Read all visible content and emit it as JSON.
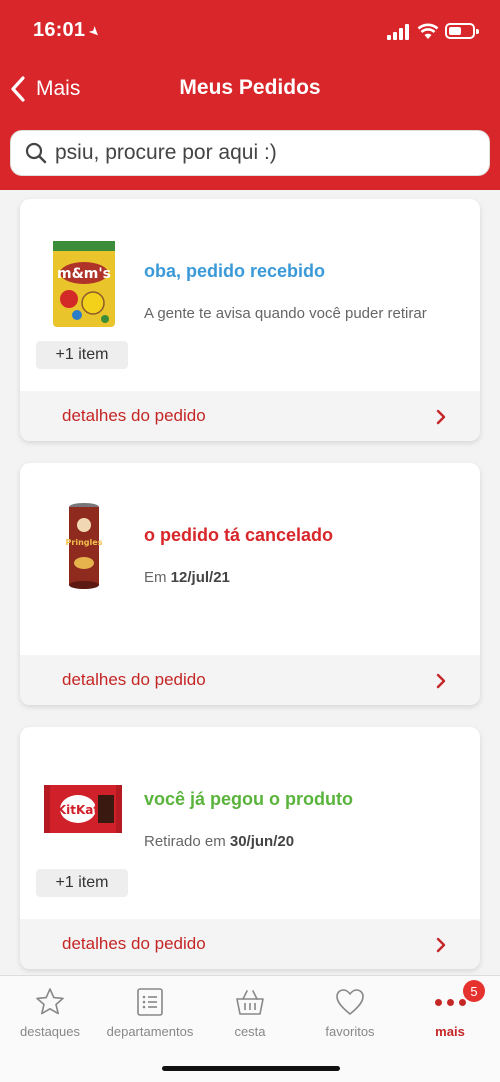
{
  "status_bar": {
    "time": "16:01"
  },
  "nav": {
    "back_label": "Mais",
    "title": "Meus Pedidos"
  },
  "search": {
    "placeholder": "psiu, procure por aqui :)"
  },
  "orders": [
    {
      "product_image": "mms-bag",
      "extra_items": "+1 item",
      "status": "oba, pedido recebido",
      "status_color": "#3a9ad9",
      "subtitle": "A gente te avisa quando você puder retirar",
      "details_label": "detalhes do pedido"
    },
    {
      "product_image": "pringles-can",
      "status": "o pedido tá cancelado",
      "status_color": "#d8262a",
      "subtitle_prefix": "Em",
      "subtitle_date": "12/jul/21",
      "details_label": "detalhes do pedido"
    },
    {
      "product_image": "kitkat-bar",
      "extra_items": "+1 item",
      "status": "você já pegou o produto",
      "status_color": "#5ab43c",
      "subtitle_prefix": "Retirado em",
      "subtitle_date": "30/jun/20",
      "details_label": "detalhes do pedido"
    }
  ],
  "tabbar": {
    "items": [
      {
        "label": "destaques",
        "icon": "star-icon"
      },
      {
        "label": "departamentos",
        "icon": "list-icon"
      },
      {
        "label": "cesta",
        "icon": "basket-icon"
      },
      {
        "label": "favoritos",
        "icon": "heart-icon"
      },
      {
        "label": "mais",
        "icon": "more-dots-icon",
        "badge": "5",
        "active": true
      }
    ]
  },
  "colors": {
    "brand_red": "#d8262a",
    "link_red": "#c52626"
  }
}
